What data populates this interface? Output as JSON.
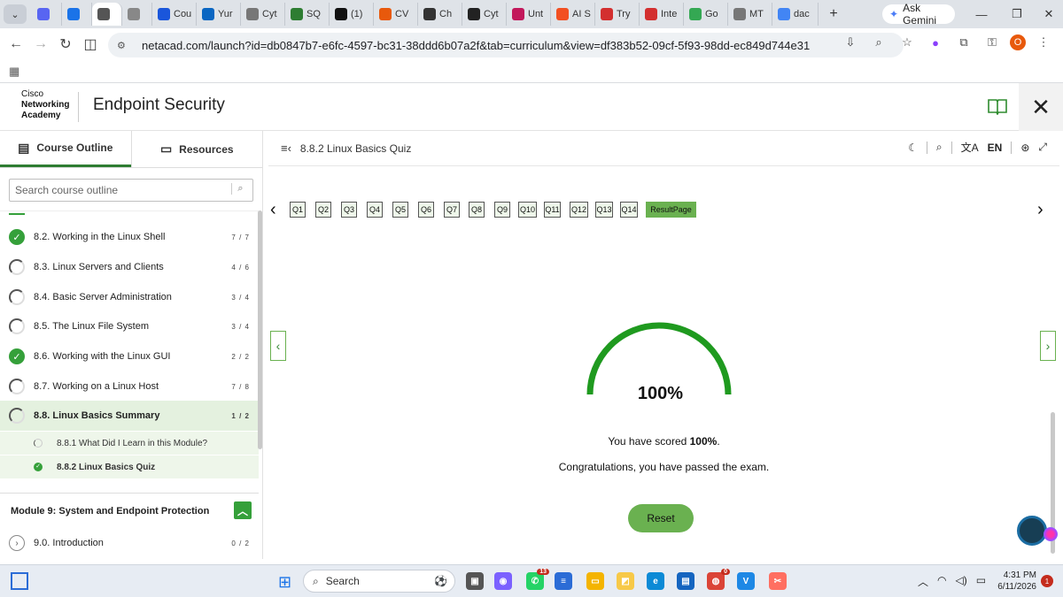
{
  "browser": {
    "tabs": [
      {
        "label": "",
        "icon": "discord-icon",
        "color": "#5865f2"
      },
      {
        "label": "",
        "icon": "tab-icon",
        "color": "#1a73e8"
      },
      {
        "label": "",
        "icon": "cisco-icon",
        "color": "#555555"
      },
      {
        "label": "",
        "icon": "page-icon",
        "color": "#888888"
      },
      {
        "label": "Cou",
        "icon": "c-icon",
        "color": "#1a56db"
      },
      {
        "label": "Yur",
        "icon": "linkedin-icon",
        "color": "#0a66c2"
      },
      {
        "label": "Cyt",
        "icon": "globe-icon",
        "color": "#777777"
      },
      {
        "label": "SQ",
        "icon": "w-icon",
        "color": "#2e7d32"
      },
      {
        "label": "(1)",
        "icon": "x-icon",
        "color": "#111111"
      },
      {
        "label": "CV",
        "icon": "star-icon",
        "color": "#e8590c"
      },
      {
        "label": "Ch",
        "icon": "chatgpt-icon",
        "color": "#333333"
      },
      {
        "label": "Cyt",
        "icon": "terminal-icon",
        "color": "#222222"
      },
      {
        "label": "Unt",
        "icon": "chart-icon",
        "color": "#c2185b"
      },
      {
        "label": "AI S",
        "icon": "microsoft-icon",
        "color": "#f25022"
      },
      {
        "label": "Try",
        "icon": "warning-icon",
        "color": "#d32f2f"
      },
      {
        "label": "Inte",
        "icon": "gauge-icon",
        "color": "#d32f2f"
      },
      {
        "label": "Go",
        "icon": "maps-icon",
        "color": "#34a853"
      },
      {
        "label": "MT",
        "icon": "globe-icon",
        "color": "#777777"
      },
      {
        "label": "dac",
        "icon": "google-icon",
        "color": "#4285f4"
      }
    ],
    "new_tab": "+",
    "gemini_label": "Ask Gemini",
    "url": "netacad.com/launch?id=db0847b7-e6fc-4597-bc31-38ddd6b07a2f&tab=curriculum&view=df383b52-09cf-5f93-98dd-ec849d744e31",
    "profile_initial": "O"
  },
  "header": {
    "logo_line1": "Cisco",
    "logo_line2": "Networking",
    "logo_line3": "Academy",
    "course_title": "Endpoint Security"
  },
  "sidebar": {
    "tab_outline": "Course Outline",
    "tab_resources": "Resources",
    "search_placeholder": "Search course outline",
    "items": [
      {
        "label": "8.2. Working in the Linux Shell",
        "count": "7 / 7",
        "status": "done"
      },
      {
        "label": "8.3. Linux Servers and Clients",
        "count": "4 / 6",
        "status": "partial"
      },
      {
        "label": "8.4. Basic Server Administration",
        "count": "3 / 4",
        "status": "partial"
      },
      {
        "label": "8.5. The Linux File System",
        "count": "3 / 4",
        "status": "partial"
      },
      {
        "label": "8.6. Working with the Linux GUI",
        "count": "2 / 2",
        "status": "done"
      },
      {
        "label": "8.7. Working on a Linux Host",
        "count": "7 / 8",
        "status": "partial"
      },
      {
        "label": "8.8. Linux Basics Summary",
        "count": "1 / 2",
        "status": "partial"
      }
    ],
    "subitems": [
      {
        "label": "8.8.1 What Did I Learn in this Module?",
        "status": "partial"
      },
      {
        "label": "8.8.2 Linux Basics Quiz",
        "status": "done"
      }
    ],
    "module_title": "Module 9: System and Endpoint Protection",
    "module_item": {
      "label": "9.0. Introduction",
      "count": "0 / 2"
    }
  },
  "main": {
    "page_title": "8.8.2 Linux Basics Quiz",
    "language": "EN",
    "questions": [
      "Q1",
      "Q2",
      "Q3",
      "Q4",
      "Q5",
      "Q6",
      "Q7",
      "Q8",
      "Q9",
      "Q10",
      "Q11",
      "Q12",
      "Q13",
      "Q14"
    ],
    "result_label": "ResultPage",
    "score_percent": "100%",
    "score_fraction": 1.0,
    "score_prefix": "You have scored ",
    "score_value": "100%",
    "score_suffix": ".",
    "congrats": "Congratulations, you have passed the exam.",
    "reset_label": "Reset",
    "accent": "#6ab150",
    "gauge_color": "#1f9a1f"
  },
  "taskbar": {
    "search_label": "Search",
    "whatsapp_badge": "13",
    "chrome_badge": "0",
    "time": "4:31 PM",
    "date": "6/11/2026",
    "notifications": "1"
  }
}
